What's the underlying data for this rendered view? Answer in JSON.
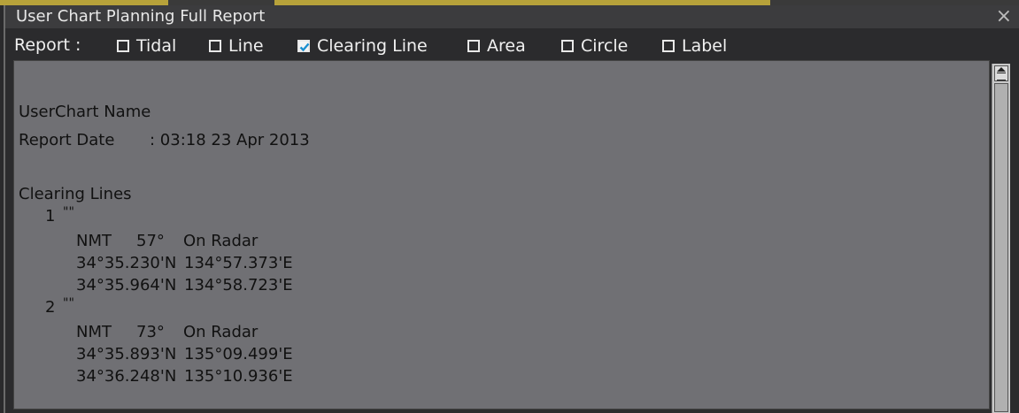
{
  "window": {
    "title": "User Chart Planning Full Report",
    "close_glyph": "×"
  },
  "report_bar": {
    "label": "Report :",
    "options": [
      {
        "label": "Tidal",
        "checked": false
      },
      {
        "label": "Line",
        "checked": false
      },
      {
        "label": "Clearing Line",
        "checked": true
      },
      {
        "label": "Area",
        "checked": false
      },
      {
        "label": "Circle",
        "checked": false
      },
      {
        "label": "Label",
        "checked": false
      }
    ]
  },
  "report": {
    "name_label": "UserChart Name",
    "date_label": "Report Date",
    "date_value": ": 03:18 23 Apr 2013",
    "section_title": "Clearing Lines",
    "entries": [
      {
        "index": "1",
        "name": "\"\"",
        "type": "NMT",
        "bearing": "57°",
        "mode": "On Radar",
        "points": [
          {
            "lat": "34°35.230'N",
            "lon": "134°57.373'E"
          },
          {
            "lat": "34°35.964'N",
            "lon": "134°58.723'E"
          }
        ]
      },
      {
        "index": "2",
        "name": "\"\"",
        "type": "NMT",
        "bearing": "73°",
        "mode": "On Radar",
        "points": [
          {
            "lat": "34°35.893'N",
            "lon": "135°09.499'E"
          },
          {
            "lat": "34°36.248'N",
            "lon": "135°10.936'E"
          }
        ]
      }
    ]
  },
  "colors": {
    "content_bg": "#707074",
    "check_accent": "#1b8fd0"
  }
}
